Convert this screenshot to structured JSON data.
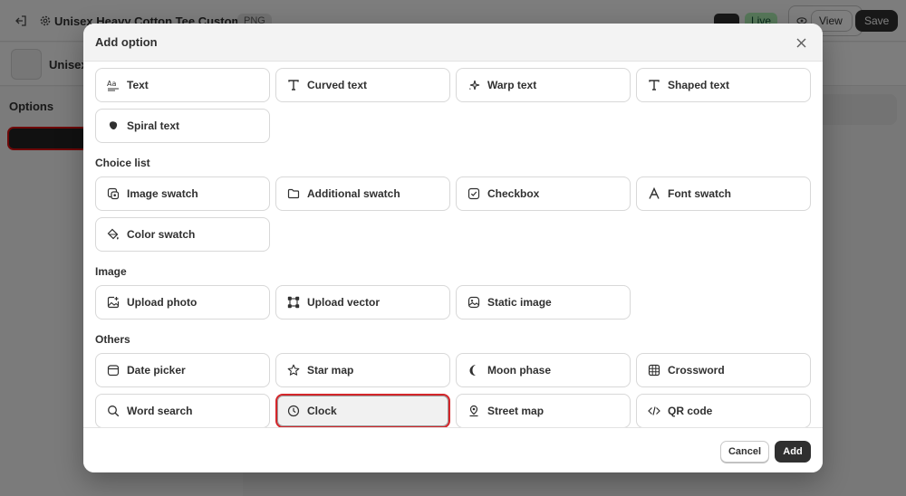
{
  "background": {
    "title": "Unisex Heavy Cotton Tee Customix",
    "badge": "PNG",
    "live": "Live",
    "view": "View",
    "save": "Save",
    "product_name": "Unisex",
    "sidebar_heading": "Options"
  },
  "modal": {
    "title": "Add option",
    "sections": {
      "text_options": [
        {
          "label": "Text",
          "icon": "text-style-icon"
        },
        {
          "label": "Curved text",
          "icon": "type-icon"
        },
        {
          "label": "Warp text",
          "icon": "sparkle-icon"
        },
        {
          "label": "Shaped text",
          "icon": "type-icon"
        },
        {
          "label": "Spiral text",
          "icon": "blob-icon"
        }
      ],
      "choice_list": {
        "heading": "Choice list",
        "items": [
          {
            "label": "Image swatch",
            "icon": "image-swatch-icon"
          },
          {
            "label": "Additional swatch",
            "icon": "folder-icon"
          },
          {
            "label": "Checkbox",
            "icon": "checkbox-icon"
          },
          {
            "label": "Font swatch",
            "icon": "font-a-icon"
          },
          {
            "label": "Color swatch",
            "icon": "paint-bucket-icon"
          }
        ]
      },
      "image": {
        "heading": "Image",
        "items": [
          {
            "label": "Upload photo",
            "icon": "upload-photo-icon"
          },
          {
            "label": "Upload vector",
            "icon": "vector-icon"
          },
          {
            "label": "Static image",
            "icon": "static-image-icon"
          }
        ]
      },
      "others": {
        "heading": "Others",
        "items": [
          {
            "label": "Date picker",
            "icon": "calendar-icon"
          },
          {
            "label": "Star map",
            "icon": "star-icon"
          },
          {
            "label": "Moon phase",
            "icon": "moon-icon"
          },
          {
            "label": "Crossword",
            "icon": "grid-icon"
          },
          {
            "label": "Word search",
            "icon": "search-icon"
          },
          {
            "label": "Clock",
            "icon": "clock-icon"
          },
          {
            "label": "Street map",
            "icon": "map-pin-icon"
          },
          {
            "label": "QR code",
            "icon": "code-icon"
          }
        ]
      }
    },
    "selected": "Clock",
    "footer": {
      "cancel": "Cancel",
      "add": "Add"
    }
  },
  "colors": {
    "selection_outline": "#d4262b",
    "primary_button": "#303030",
    "live_badge": "#aff0b5"
  }
}
